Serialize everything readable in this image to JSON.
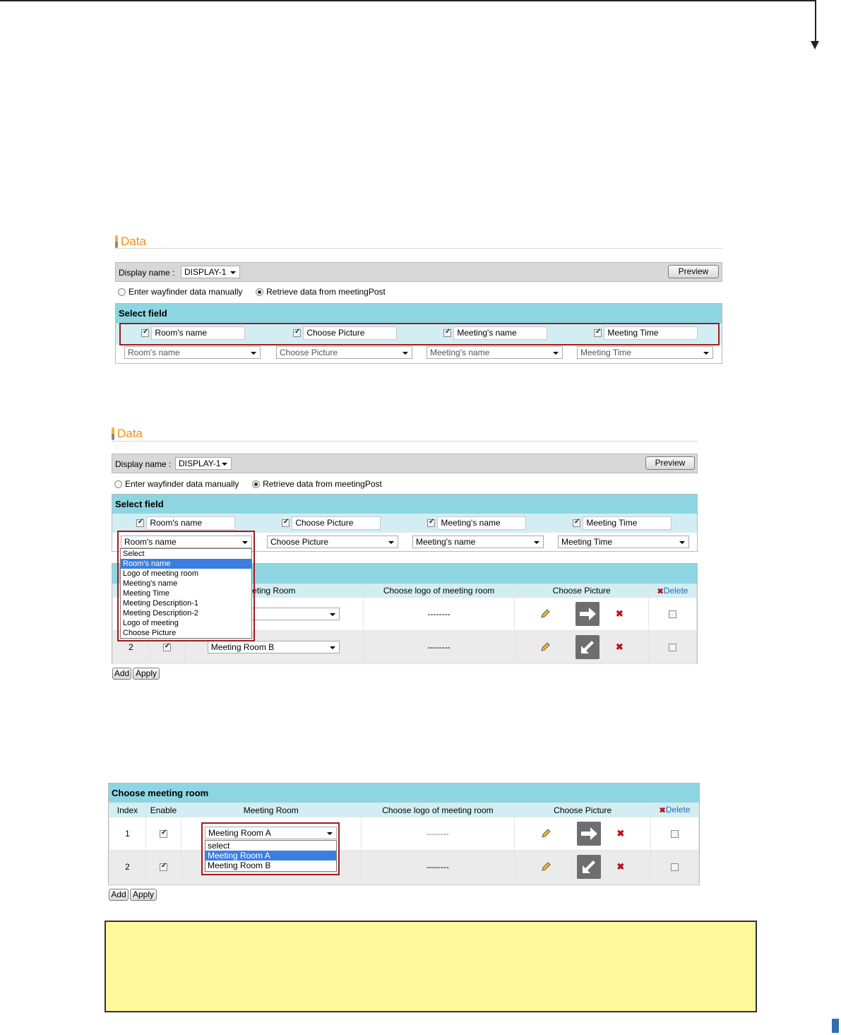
{
  "section": {
    "title": "Data"
  },
  "display": {
    "label": "Display name :",
    "value": "DISPLAY-1",
    "preview": "Preview"
  },
  "radios": {
    "manual": "Enter wayfinder data manually",
    "retrieve": "Retrieve data from meetingPost"
  },
  "select_field": {
    "title": "Select field",
    "fields": [
      "Room's name",
      "Choose Picture",
      "Meeting's name",
      "Meeting Time"
    ],
    "dropdowns": [
      "Room's name",
      "Choose Picture",
      "Meeting's name",
      "Meeting Time"
    ]
  },
  "field_options": [
    "Select",
    "Room's name",
    "Logo of meeting room",
    "Meeting's name",
    "Meeting Time",
    "Meeting Description-1",
    "Meeting Description-2",
    "Logo of meeting",
    "Choose Picture"
  ],
  "room_table": {
    "title": "Choose meeting room",
    "headers": {
      "index": "Index",
      "enable": "Enable",
      "room": "Meeting Room",
      "logo": "Choose logo of meeting room",
      "picture": "Choose Picture",
      "delete": "Delete"
    },
    "partial_header_room": "eting Room",
    "partial_row1_room": "m A",
    "rows": [
      {
        "index": "1",
        "room": "Meeting Room A",
        "logo": "--------"
      },
      {
        "index": "2",
        "room": "Meeting Room B",
        "logo": "--------"
      }
    ]
  },
  "room_options": [
    "select",
    "Meeting Room A",
    "Meeting Room B"
  ],
  "buttons": {
    "add": "Add",
    "apply": "Apply"
  },
  "icons": {
    "pencil": "pencil-icon",
    "right_arrow": "arrow-right-icon",
    "down_left_arrow": "arrow-down-left-icon",
    "remove": "remove-icon",
    "delete": "delete-icon"
  },
  "colors": {
    "accent_orange": "#f0900f",
    "panel_header": "#8dd6e1",
    "panel_strip": "#d3eef3",
    "highlight_box": "#a31b1f",
    "note_bg": "#fff99c",
    "selection": "#3c7ee0"
  }
}
